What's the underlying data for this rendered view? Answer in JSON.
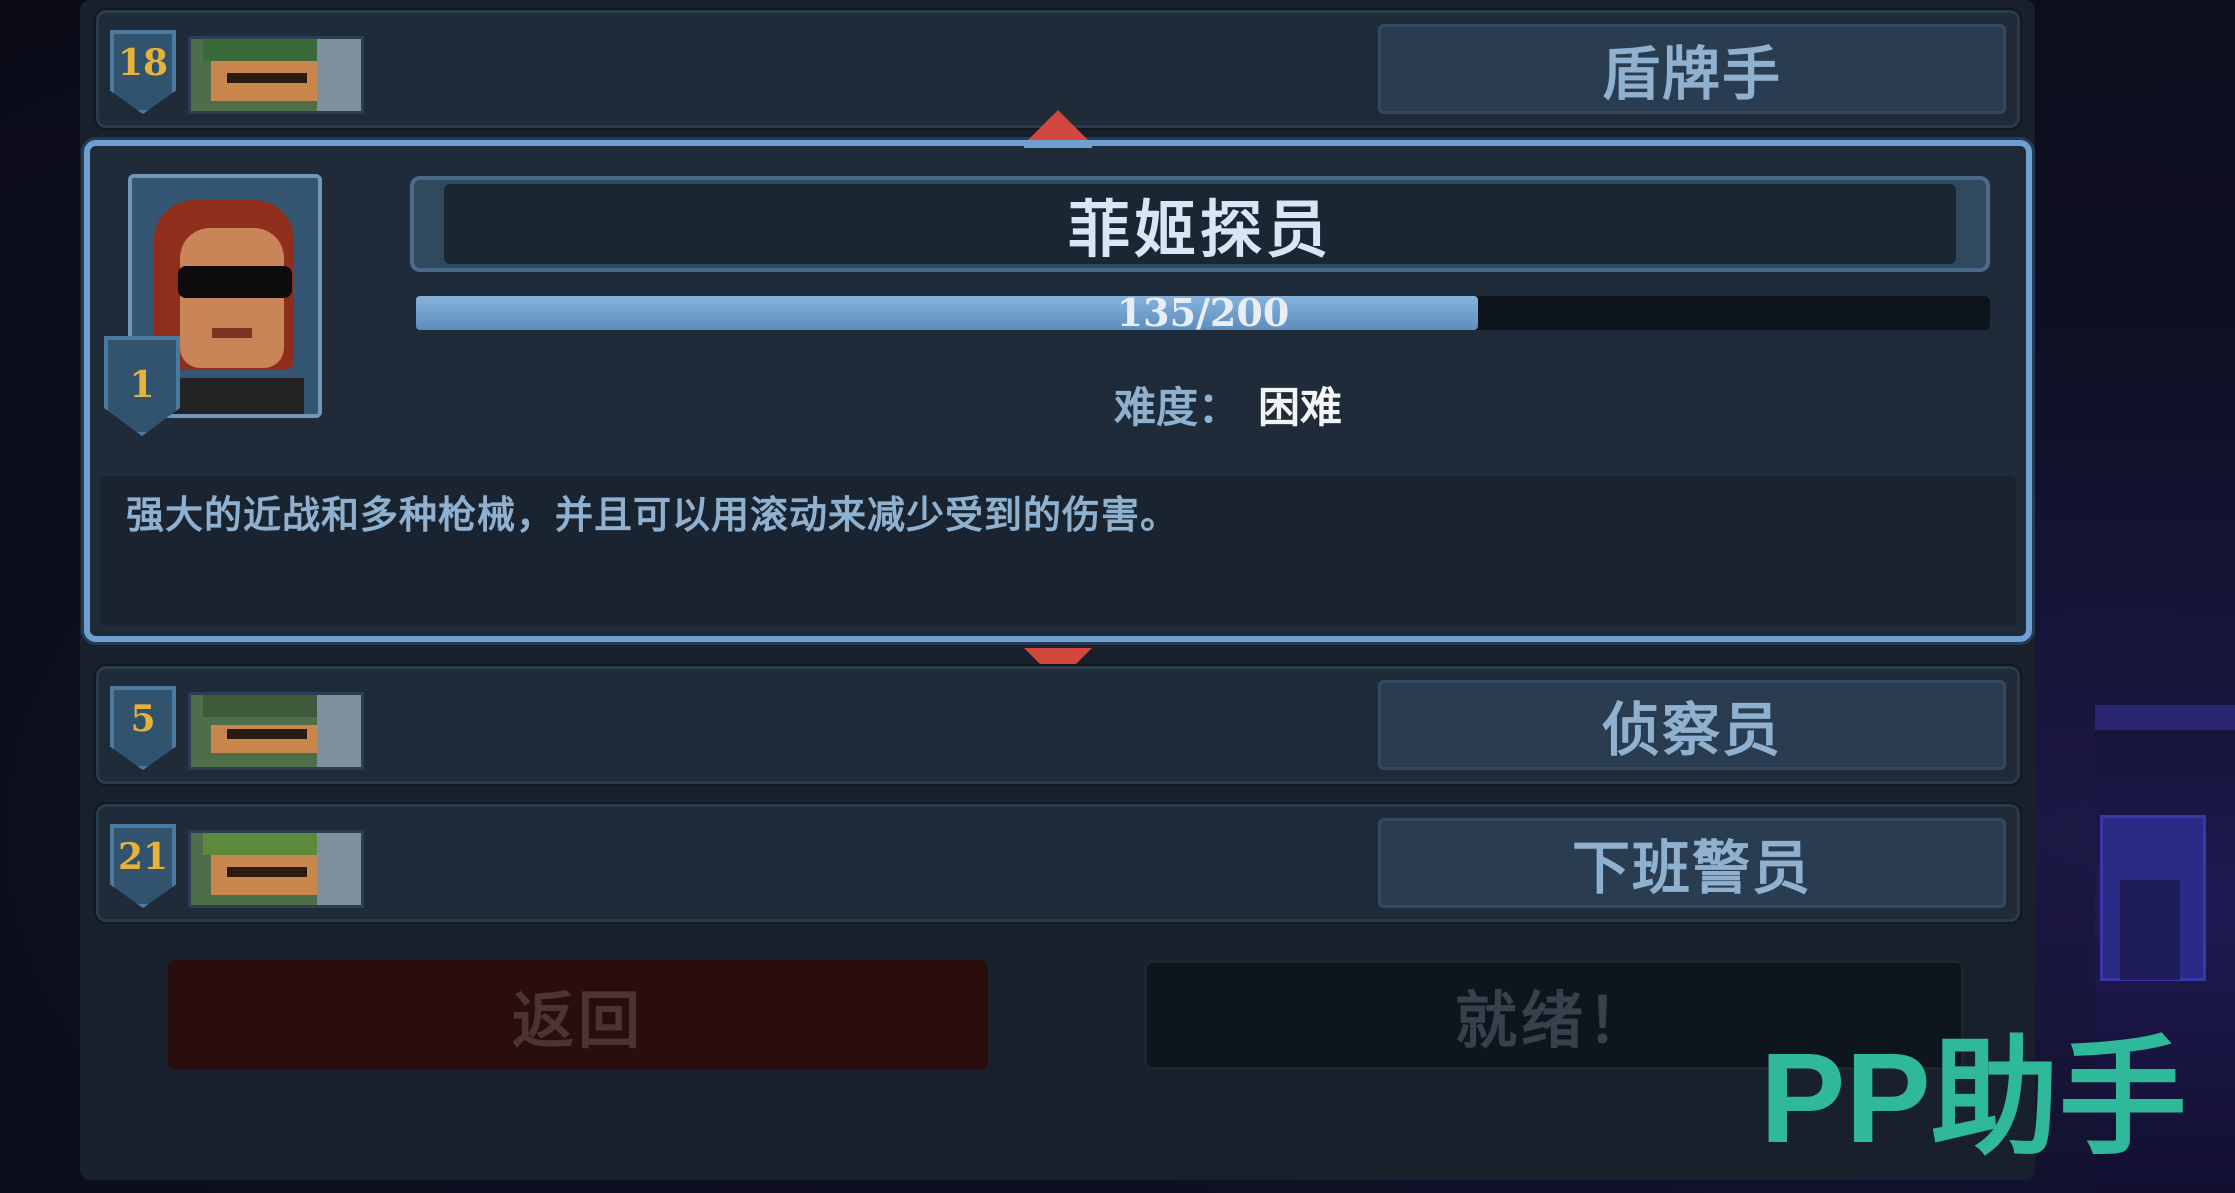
{
  "characters": [
    {
      "level": "18",
      "name": "盾牌手"
    },
    {
      "level": "5",
      "name": "侦察员"
    },
    {
      "level": "21",
      "name": "下班警员"
    }
  ],
  "selected": {
    "level": "1",
    "name": "菲姬探员",
    "progress_text": "135/200",
    "progress_fraction": 0.675,
    "difficulty_label": "难度：",
    "difficulty_value": "困难",
    "description": "强大的近战和多种枪械，并且可以用滚动来减少受到的伤害。"
  },
  "buttons": {
    "back": "返回",
    "ready": "就绪！"
  },
  "watermark": "PP助手",
  "colors": {
    "accent": "#6ea0d2",
    "arrow": "#d2473e",
    "level_gold": "#e8b13a",
    "watermark": "#2fb89a"
  }
}
